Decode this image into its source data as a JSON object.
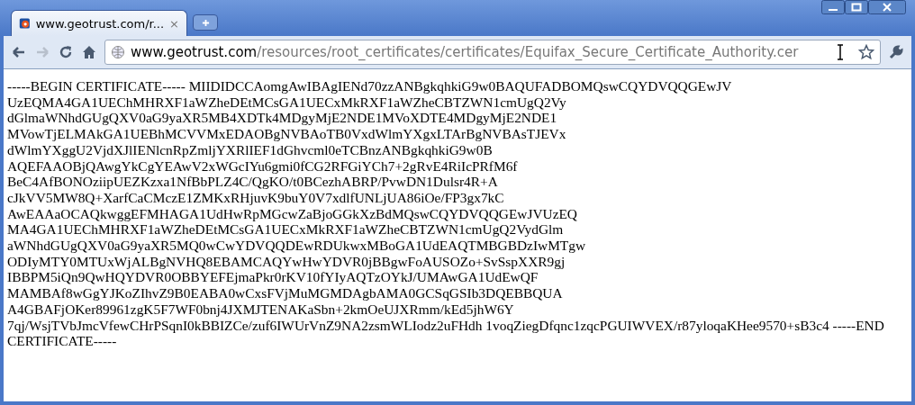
{
  "tabs": [
    {
      "title": "www.geotrust.com/r...",
      "close": "×",
      "selected": true
    }
  ],
  "address_bar": {
    "host": "www.geotrust.com",
    "path": "/resources/root_certificates/certificates/Equifax_Secure_Certificate_Authority.cer"
  },
  "document": {
    "lines": [
      "-----BEGIN CERTIFICATE----- MIIDIDCCAomgAwIBAgIENd70zzANBgkqhkiG9w0BAQUFADBOMQswCQYDVQQGEwJV",
      "UzEQMA4GA1UEChMHRXF1aWZheDEtMCsGA1UECxMkRXF1aWZheCBTZWN1cmUgQ2Vy",
      "dGlmaWNhdGUgQXV0aG9yaXR5MB4XDTk4MDgyMjE2NDE1MVoXDTE4MDgyMjE2NDE1",
      "MVowTjELMAkGA1UEBhMCVVMxEDAOBgNVBAoTB0VxdWlmYXgxLTArBgNVBAsTJEVx",
      "dWlmYXggU2VjdXJlIENlcnRpZmljYXRlIEF1dGhvcml0eTCBnzANBgkqhkiG9w0B",
      "AQEFAAOBjQAwgYkCgYEAwV2xWGcIYu6gmi0fCG2RFGiYCh7+2gRvE4RiIcPRfM6f",
      "BeC4AfBONOziipUEZKzxa1NfBbPLZ4C/QgKO/t0BCezhABRP/PvwDN1Dulsr4R+A",
      "cJkVV5MW8Q+XarfCaCMczE1ZMKxRHjuvK9buY0V7xdlfUNLjUA86iOe/FP3gx7kC",
      "AwEAAaOCAQkwggEFMHAGA1UdHwRpMGcwZaBjoGGkXzBdMQswCQYDVQQGEwJVUzEQ",
      "MA4GA1UEChMHRXF1aWZheDEtMCsGA1UECxMkRXF1aWZheCBTZWN1cmUgQ2VydGlm",
      "aWNhdGUgQXV0aG9yaXR5MQ0wCwYDVQQDEwRDUkwxMBoGA1UdEAQTMBGBDzIwMTgw",
      "ODIyMTY0MTUxWjALBgNVHQ8EBAMCAQYwHwYDVR0jBBgwFoAUSOZo+SvSspXXR9gj",
      "IBBPM5iQn9QwHQYDVR0OBBYEFEjmaPkr0rKV10fYIyAQTzOYkJ/UMAwGA1UdEwQF",
      "MAMBAf8wGgYJKoZIhvZ9B0EABA0wCxsFVjMuMGMDAgbAMA0GCSqGSIb3DQEBBQUA",
      "A4GBAFjOKer89961zgK5F7WF0bnj4JXMJTENAKaSbn+2kmOeUJXRmm/kEd5jhW6Y",
      "7qj/WsjTVbJmcVfewCHrPSqnI0kBBIZCe/zuf6IWUrVnZ9NA2zsmWLIodz2uFHdh 1voqZiegDfqnc1zqcPGUIWVEX/r87yloqaKHee9570+sB3c4 -----END",
      "CERTIFICATE-----"
    ]
  }
}
